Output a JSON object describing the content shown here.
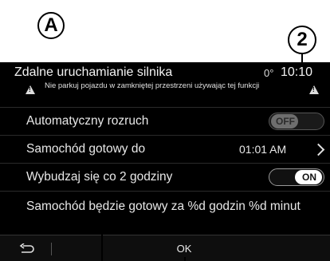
{
  "callouts": {
    "a": "A",
    "two": "2"
  },
  "header": {
    "title": "Zdalne uruchamianie silnika",
    "temperature": "0°",
    "clock": "10:10",
    "warning": "Nie parkuj pojazdu w zamkniętej przestrzeni używając tej funkcji"
  },
  "rows": {
    "auto_start": {
      "label": "Automatyczny rozruch",
      "toggle": "OFF"
    },
    "ready_at": {
      "label": "Samochód gotowy do",
      "time": "01:01 AM"
    },
    "wake": {
      "label": "Wybudzaj się co 2 godziny",
      "toggle": "ON"
    },
    "info": {
      "label": "Samochód będzie gotowy za %d godzin %d minut"
    }
  },
  "footer": {
    "ok_label": "OK"
  },
  "icons": {
    "warning": "warning-triangle-icon",
    "chevron": "chevron-right-icon",
    "back": "back-arrow-icon"
  }
}
